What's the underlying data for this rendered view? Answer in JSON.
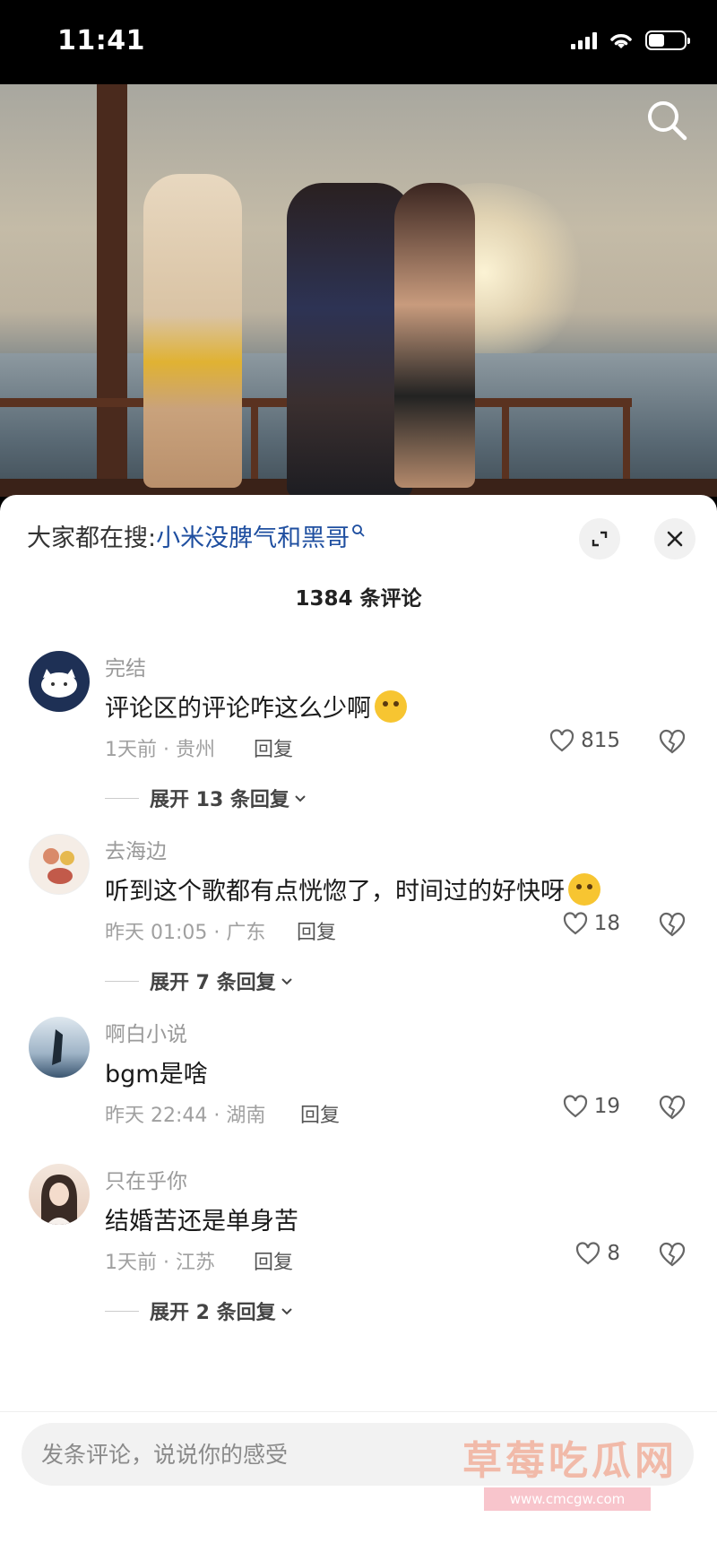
{
  "status": {
    "time": "11:41"
  },
  "sheet": {
    "hot_search_prefix": "大家都在搜:",
    "hot_search_term": "小米没脾气和黑哥",
    "comment_count": "1384 条评论"
  },
  "comments": [
    {
      "user": "完结",
      "text": "评论区的评论咋这么少啊",
      "emoji": "drooling-face-emoji",
      "meta": "1天前 · 贵州",
      "reply": "回复",
      "likes": "815",
      "expand": "展开 13 条回复"
    },
    {
      "user": "去海边",
      "text": "听到这个歌都有点恍惚了，时间过的好快呀",
      "emoji": "pleading-face-emoji",
      "meta": "昨天 01:05 · 广东",
      "reply": "回复",
      "likes": "18",
      "expand": "展开 7 条回复"
    },
    {
      "user": "啊白小说",
      "text": "bgm是啥",
      "meta": "昨天 22:44 · 湖南",
      "reply": "回复",
      "likes": "19"
    },
    {
      "user": "只在乎你",
      "text": "结婚苦还是单身苦",
      "meta": "1天前 · 江苏",
      "reply": "回复",
      "likes": "8",
      "expand": "展开 2 条回复"
    }
  ],
  "input": {
    "placeholder": "发条评论，说说你的感受"
  },
  "watermark": {
    "text": "草莓吃瓜网",
    "url": "www.cmcgw.com"
  },
  "colors": {
    "accent_link": "#1f4fa0",
    "sheet_bg": "#ffffff"
  }
}
